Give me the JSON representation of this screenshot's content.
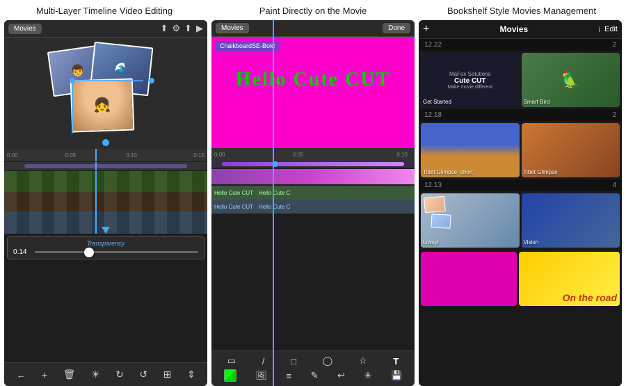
{
  "headers": [
    {
      "label": "Multi-Layer Timeline Video Editing"
    },
    {
      "label": "Paint Directly on the Movie"
    },
    {
      "label": "Bookshelf Style Movies Management"
    }
  ],
  "screen1": {
    "movies_btn": "Movies",
    "transparency_label": "Transparency",
    "transparency_value": "0.14",
    "ruler_ticks": [
      "0:00",
      "0:05",
      "0:10",
      "0:15"
    ],
    "bottom_icons": [
      "←",
      "+",
      "🗑",
      "☀",
      "↻",
      "↺",
      "⊞",
      "⇕"
    ]
  },
  "screen2": {
    "movies_btn": "Movies",
    "done_btn": "Done",
    "font_label": "ChalkboardSE-Bold",
    "hello_text": "Hello Cute CUT",
    "text_track1": "Hello Cute CUT",
    "text_track2": "Hello Cute C",
    "ruler_ticks": [
      "0:00",
      "0:05",
      "0:10"
    ],
    "tools": [
      "▭",
      "/",
      "□",
      "◯",
      "☆",
      "T"
    ],
    "tools2": [
      "🖼",
      "≡",
      "✎",
      "↩",
      "✳",
      "💾"
    ]
  },
  "screen3": {
    "plus_icon": "+",
    "title": "Movies",
    "info_icon": "i",
    "edit_btn": "Edit",
    "sections": [
      {
        "date": "12.22",
        "count": "2",
        "items": [
          {
            "label": "Get Started",
            "type": "cute-cut"
          },
          {
            "label": "Smart Bird",
            "type": "smart-bird"
          }
        ]
      },
      {
        "date": "12.18",
        "count": "2",
        "items": [
          {
            "label": "Tibet Glimpse -short",
            "type": "tibet1"
          },
          {
            "label": "Tibet Glimpse",
            "type": "tibet2"
          }
        ]
      },
      {
        "date": "12.13",
        "count": "4",
        "items": [
          {
            "label": "Lovsyl",
            "type": "lovsyl"
          },
          {
            "label": "Vision",
            "type": "vision"
          }
        ]
      },
      {
        "date": "",
        "count": "",
        "items": [
          {
            "label": "",
            "type": "magenta"
          },
          {
            "label": "On the road",
            "type": "on-road"
          }
        ]
      }
    ]
  }
}
